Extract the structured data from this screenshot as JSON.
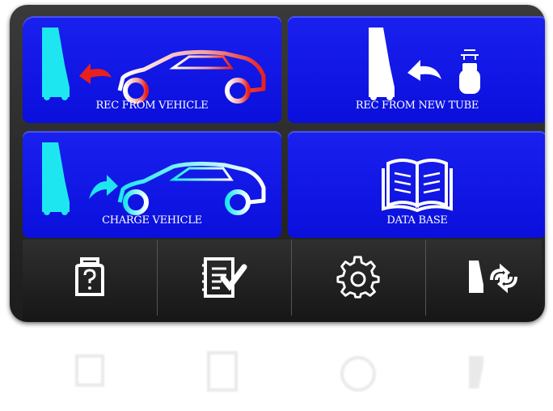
{
  "tiles": {
    "rec_from_vehicle": "REC FROM VEHICLE",
    "rec_from_new_tube": "REC FROM NEW TUBE",
    "charge_vehicle": "CHARGE VEHICLE",
    "data_base": "DATA BASE"
  },
  "toolbar_items": [
    {
      "name": "refrigerant-tank-icon"
    },
    {
      "name": "checklist-icon"
    },
    {
      "name": "gear-icon"
    },
    {
      "name": "machine-cycle-icon"
    }
  ],
  "colors": {
    "tile_blue": "#0a0fdc",
    "cyan": "#1ee6f0",
    "red_arrow": "#e8201e",
    "bar_dark": "#1c1c1c"
  },
  "reflection_icon": "mirrored-toolbar-reflection"
}
